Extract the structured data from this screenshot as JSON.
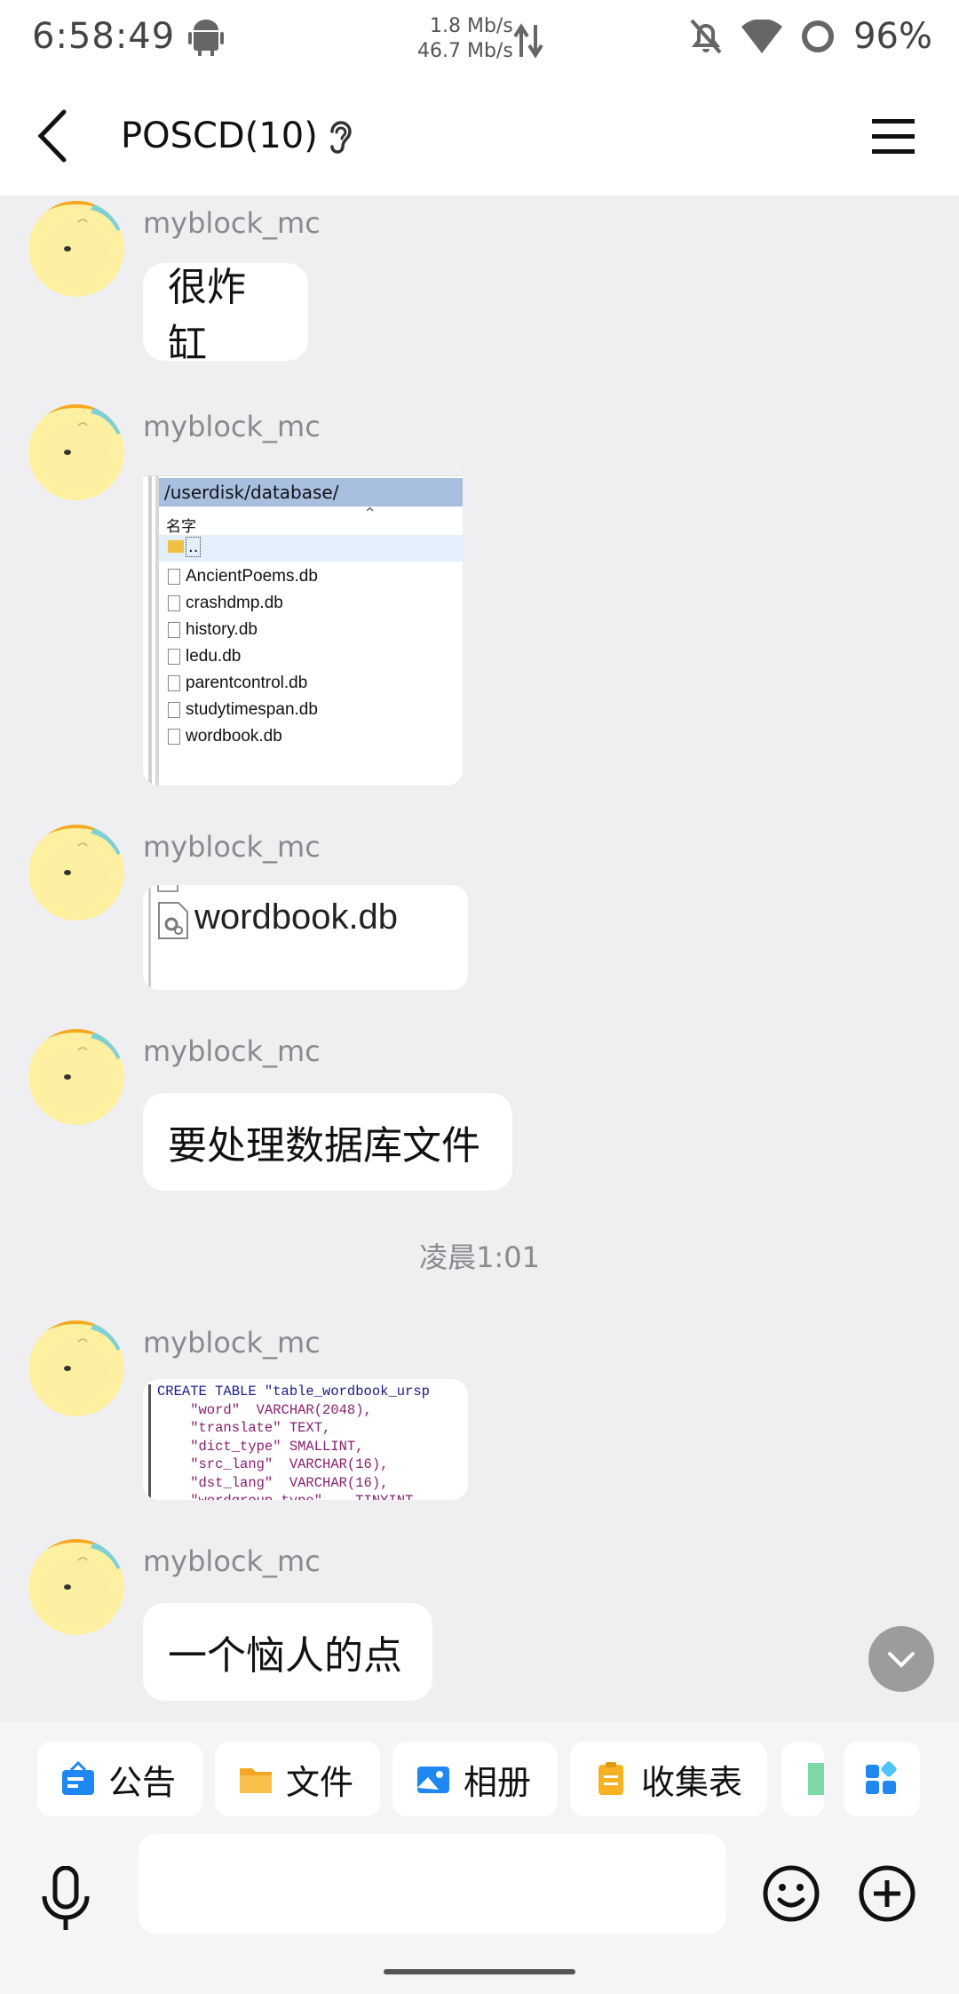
{
  "status_bar": {
    "time": "6:58:49",
    "net_up": "1.8 Mb/s",
    "net_down": "46.7 Mb/s",
    "battery": "96%"
  },
  "header": {
    "title": "POSCD(10)"
  },
  "messages": [
    {
      "user": "myblock_mc",
      "type": "text",
      "text": "很炸缸"
    },
    {
      "user": "myblock_mc",
      "type": "image",
      "path": "/userdisk/database/",
      "column_header": "名字",
      "parent_dir": "..",
      "files": [
        "AncientPoems.db",
        "crashdmp.db",
        "history.db",
        "ledu.db",
        "parentcontrol.db",
        "studytimespan.db",
        "wordbook.db"
      ]
    },
    {
      "user": "myblock_mc",
      "type": "image",
      "file": "wordbook.db"
    },
    {
      "user": "myblock_mc",
      "type": "text",
      "text": "要处理数据库文件"
    },
    {
      "user": "myblock_mc",
      "type": "image",
      "code_lines": [
        "CREATE TABLE \"table_wordbook_ursp",
        "    \"word\"  VARCHAR(2048),",
        "    \"translate\" TEXT,",
        "    \"dict_type\" SMALLINT,",
        "    \"src_lang\"  VARCHAR(16),",
        "    \"dst_lang\"  VARCHAR(16),",
        "    \"wordgroup_type\"    TINYINT"
      ]
    },
    {
      "user": "myblock_mc",
      "type": "text",
      "text": "一个恼人的点"
    }
  ],
  "timestamp": "凌晨1:01",
  "quick_actions": [
    {
      "label": "公告",
      "icon": "announcement-icon",
      "color": "#1e88f0"
    },
    {
      "label": "文件",
      "icon": "folder-icon",
      "color": "#f5a623"
    },
    {
      "label": "相册",
      "icon": "album-icon",
      "color": "#1e88f0"
    },
    {
      "label": "收集表",
      "icon": "form-icon",
      "color": "#f5b324"
    }
  ],
  "input": {
    "placeholder": ""
  },
  "colors": {
    "accent": "#1e88f0",
    "bubble": "#ffffff",
    "background": "#efeff2"
  }
}
